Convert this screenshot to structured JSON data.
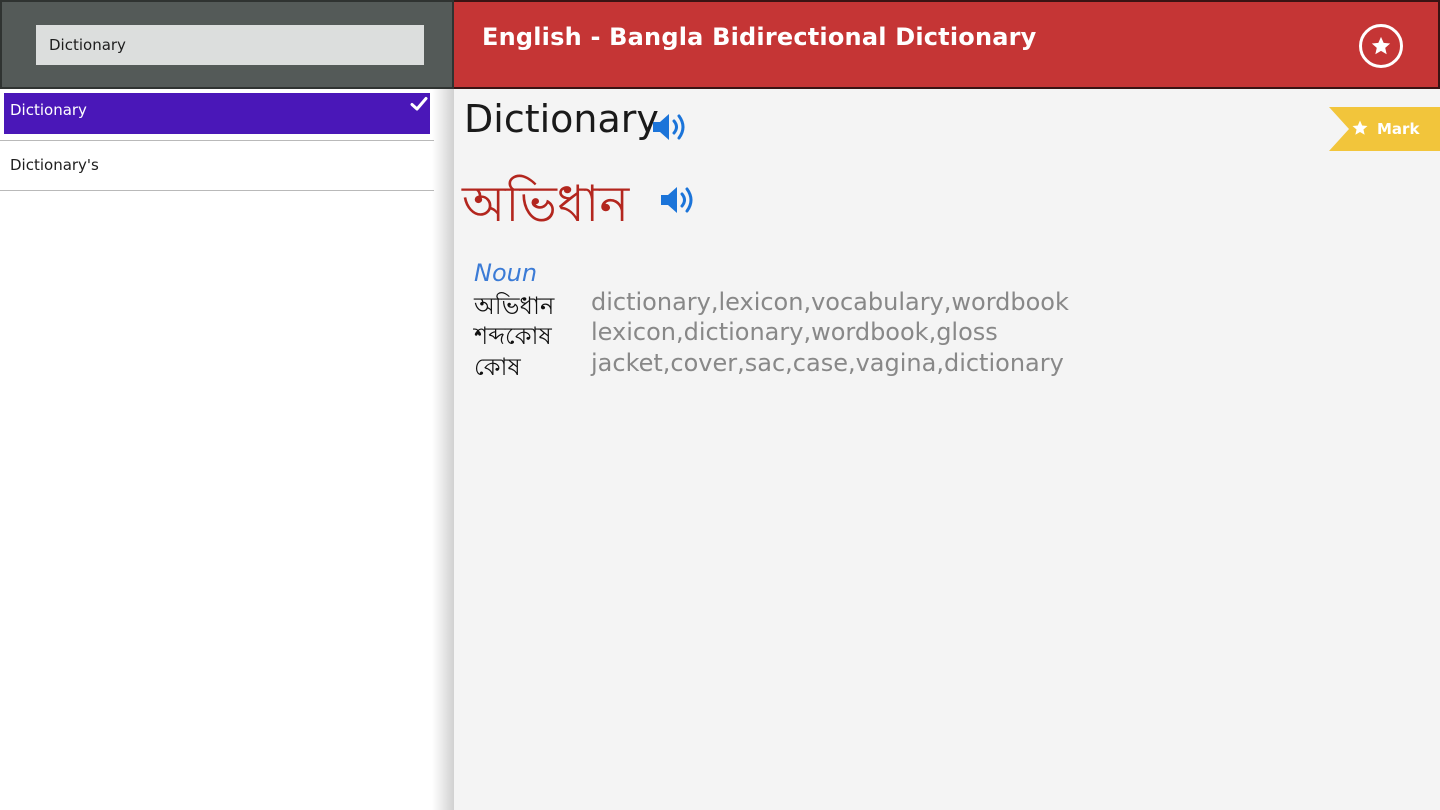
{
  "search": {
    "value": "Dictionary"
  },
  "results": [
    {
      "label": "Dictionary",
      "selected": true
    },
    {
      "label": "Dictionary's",
      "selected": false
    }
  ],
  "header": {
    "title": "English - Bangla Bidirectional Dictionary"
  },
  "entry": {
    "word": "Dictionary",
    "translation": "অভিধান",
    "mark_label": "Mark",
    "part_of_speech": "Noun",
    "definitions": [
      {
        "bangla": "অভিধান",
        "english": "dictionary,lexicon,vocabulary,wordbook"
      },
      {
        "bangla": "শব্দকোষ",
        "english": "lexicon,dictionary,wordbook,gloss"
      },
      {
        "bangla": "কোষ",
        "english": "jacket,cover,sac,case,vagina,dictionary"
      }
    ]
  },
  "icons": {
    "check": "check-icon",
    "favorites": "star-circle-icon",
    "speaker": "speaker-icon",
    "mark": "star-icon"
  },
  "colors": {
    "header_red": "#c53535",
    "selection_purple": "#4a17b8",
    "mark_yellow": "#f2c53b",
    "speaker_blue": "#1b74d9",
    "translation_red": "#b3261e",
    "pos_blue": "#3b7bd6"
  }
}
